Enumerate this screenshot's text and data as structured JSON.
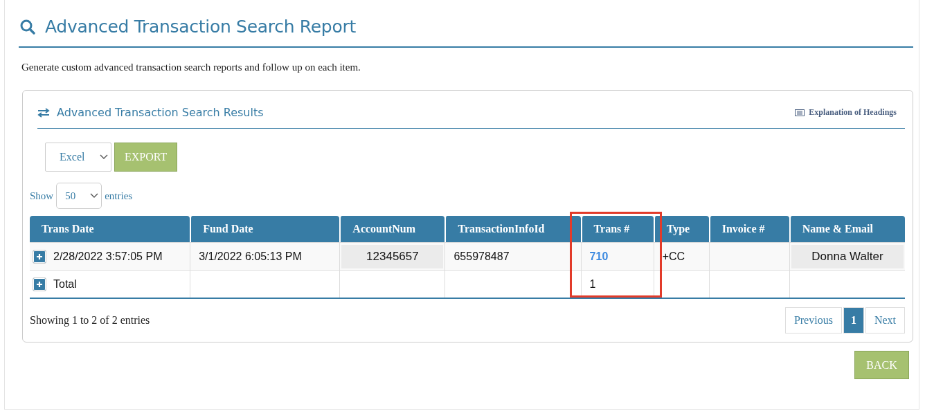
{
  "page": {
    "title": "Advanced Transaction Search Report",
    "description": "Generate custom advanced transaction search reports and follow up on each item."
  },
  "results": {
    "title": "Advanced Transaction Search Results",
    "help_link": "Explanation of Headings",
    "export": {
      "format": "Excel",
      "button": "EXPORT"
    },
    "length": {
      "before": "Show",
      "value": "50",
      "after": "entries"
    },
    "columns": [
      {
        "label": "Trans Date",
        "highlighted": false
      },
      {
        "label": "Fund Date",
        "highlighted": false
      },
      {
        "label": "AccountNum",
        "highlighted": false
      },
      {
        "label": "TransactionInfoId",
        "highlighted": false
      },
      {
        "label": "Trans #",
        "highlighted": true
      },
      {
        "label": "Type",
        "highlighted": false
      },
      {
        "label": "Invoice #",
        "highlighted": false
      },
      {
        "label": "Name & Email",
        "highlighted": false
      }
    ],
    "rows": [
      {
        "kind": "data",
        "cells": [
          {
            "text": "2/28/2022 3:57:05 PM",
            "kind": "plain"
          },
          {
            "text": "3/1/2022 6:05:13 PM",
            "kind": "plain"
          },
          {
            "text": "12345657",
            "kind": "masked"
          },
          {
            "text": "655978487",
            "kind": "plain"
          },
          {
            "text": "710",
            "kind": "link"
          },
          {
            "text": "+CC",
            "kind": "plain"
          },
          null,
          {
            "text": "Donna Walter",
            "kind": "masked"
          }
        ]
      },
      {
        "kind": "total",
        "cells": [
          {
            "text": "Total",
            "kind": "plain"
          },
          null,
          null,
          null,
          {
            "text": "1",
            "kind": "plain"
          },
          null,
          null,
          null
        ]
      }
    ],
    "info": "Showing 1 to 2 of 2 entries",
    "pages": [
      {
        "label": "Previous",
        "selected": false
      },
      {
        "label": "1",
        "selected": true
      },
      {
        "label": "Next",
        "selected": false
      }
    ]
  },
  "back": "BACK"
}
